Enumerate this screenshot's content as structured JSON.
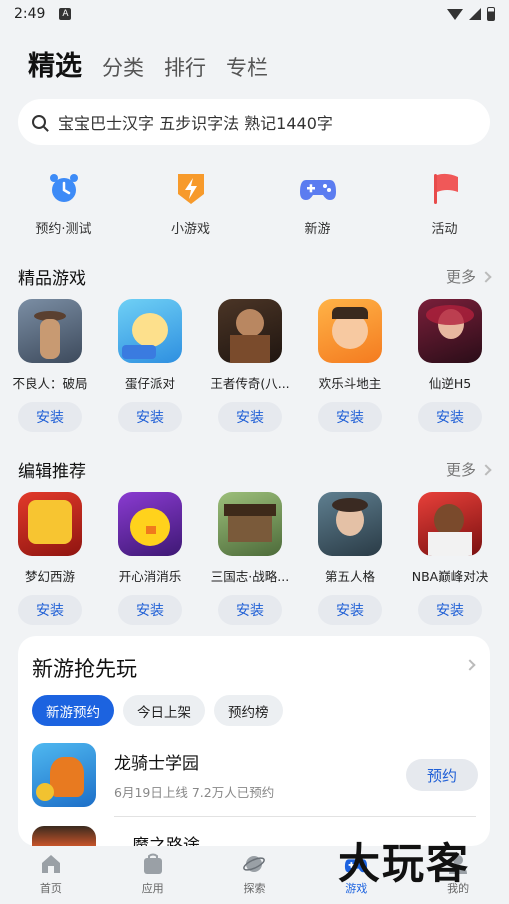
{
  "status": {
    "time": "2:49",
    "badge": "A"
  },
  "tabs": [
    {
      "label": "精选",
      "active": true
    },
    {
      "label": "分类"
    },
    {
      "label": "排行"
    },
    {
      "label": "专栏"
    }
  ],
  "search": {
    "text": "宝宝巴士汉字 五步识字法 熟记1440字"
  },
  "quick": [
    {
      "label": "预约·测试",
      "icon": "alarm-clock-icon"
    },
    {
      "label": "小游戏",
      "icon": "lightning-badge-icon"
    },
    {
      "label": "新游",
      "icon": "gamepad-icon"
    },
    {
      "label": "活动",
      "icon": "flag-icon"
    }
  ],
  "featured": {
    "title": "精品游戏",
    "more": "更多",
    "apps": [
      {
        "name": "不良人：破局",
        "install": "安装"
      },
      {
        "name": "蛋仔派对",
        "install": "安装"
      },
      {
        "name": "王者传奇(八...",
        "install": "安装"
      },
      {
        "name": "欢乐斗地主",
        "install": "安装"
      },
      {
        "name": "仙逆H5",
        "install": "安装"
      }
    ]
  },
  "editor": {
    "title": "编辑推荐",
    "more": "更多",
    "apps": [
      {
        "name": "梦幻西游",
        "install": "安装"
      },
      {
        "name": "开心消消乐",
        "install": "安装"
      },
      {
        "name": "三国志·战略...",
        "install": "安装"
      },
      {
        "name": "第五人格",
        "install": "安装"
      },
      {
        "name": "NBA巅峰对决",
        "install": "安装"
      }
    ]
  },
  "newgames": {
    "title": "新游抢先玩",
    "pills": [
      "新游预约",
      "今日上架",
      "预约榜"
    ],
    "game": {
      "name": "龙骑士学园",
      "date": "6月19日上线",
      "count": "7.2万人已预约",
      "button": "预约"
    },
    "next_name": "魔之路途"
  },
  "nav": [
    {
      "label": "首页",
      "icon": "home-icon"
    },
    {
      "label": "应用",
      "icon": "bag-icon"
    },
    {
      "label": "探索",
      "icon": "planet-icon"
    },
    {
      "label": "游戏",
      "icon": "game-icon",
      "active": true
    },
    {
      "label": "我的",
      "icon": "user-icon"
    }
  ],
  "watermark": "大玩客",
  "colors": {
    "accent": "#1c63e0",
    "background": "#f1f3f5"
  }
}
